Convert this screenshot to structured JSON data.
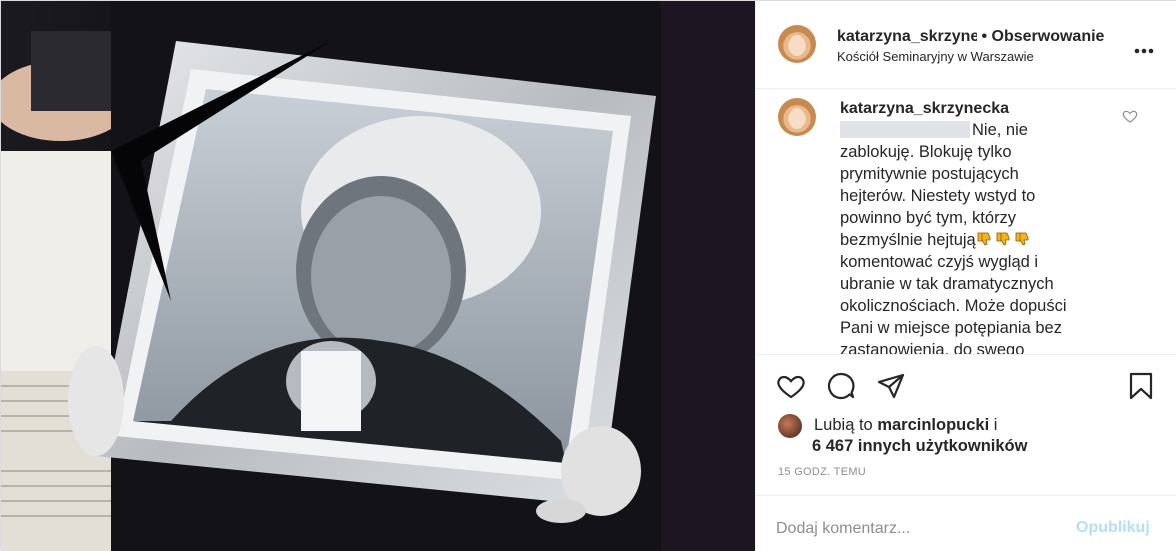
{
  "post": {
    "author": "katarzyna_skrzyne",
    "separator": "•",
    "follow_label": "Obserwowanie",
    "location": "Kościół Seminaryjny w Warszawie",
    "more_icon": "more-horizontal-icon"
  },
  "comment": {
    "author": "katarzyna_skrzynecka",
    "text_start": "Nie, nie zablokuję. Blokuję tylko prymitywnie postujących hejterów. Niestety wstyd to powinno być tym, którzy bezmyślnie hejtują",
    "emoji": [
      "👎",
      "👎",
      "👎"
    ],
    "text_end": " komentować czyjś wygląd i ubranie w tak dramatycznych okolicznościach. Może dopuści Pani w miejsce potępiania bez zastanowienia, do swego"
  },
  "likes": {
    "prefix": "Lubią to",
    "liker": "marcinlopucki",
    "suffix": "i",
    "others": "6 467 innych użytkowników"
  },
  "timestamp": "15 GODZ. TEMU",
  "add_comment": {
    "placeholder": "Dodaj komentarz...",
    "post_label": "Opublikuj"
  },
  "colors": {
    "link_disabled": "#b2dffc",
    "muted": "#8e8e8e",
    "text": "#262626",
    "border": "#efefef"
  },
  "icons": [
    "heart-icon",
    "comment-icon",
    "share-icon",
    "bookmark-icon",
    "like-comment-heart-icon"
  ]
}
